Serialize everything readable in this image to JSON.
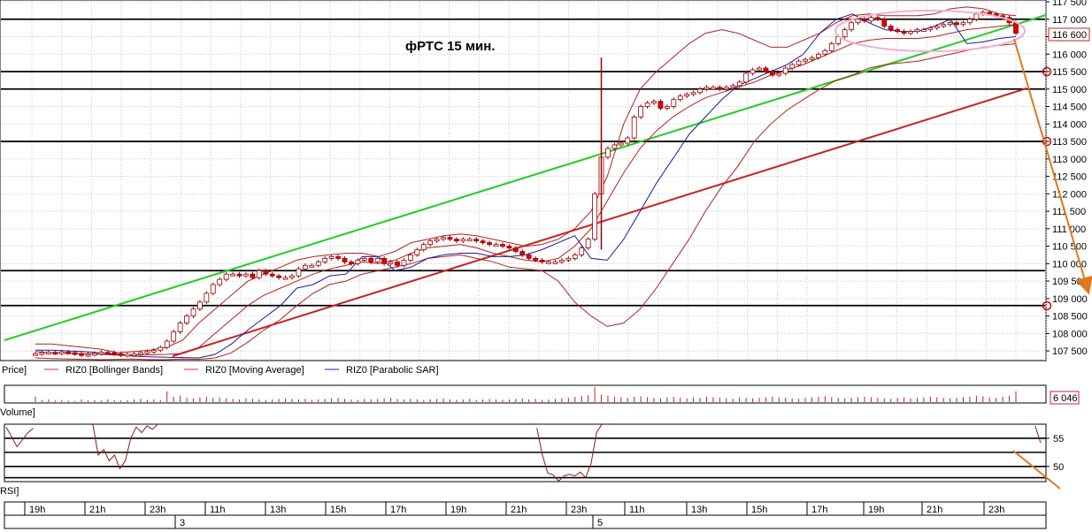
{
  "chart_data": [
    {
      "type": "candlestick",
      "title": "фРТС   15 мин.",
      "ylim": [
        107300,
        117500
      ],
      "y_ticks": [
        107500,
        108000,
        108500,
        109000,
        109500,
        110000,
        110500,
        111000,
        111500,
        112000,
        112500,
        113000,
        113500,
        114000,
        114500,
        115000,
        115500,
        116000,
        116500,
        117000,
        117500
      ],
      "y_tick_labels": [
        "107 500",
        "108 000",
        "108 500",
        "109 000",
        "109 500",
        "110 000",
        "110 500",
        "111 000",
        "111 500",
        "112 000",
        "112 500",
        "113 000",
        "113 500",
        "114 000",
        "114 500",
        "115 000",
        "115 500",
        "116 000",
        "116 500",
        "117 000",
        "117 500"
      ],
      "last_price_label": "116 600",
      "legend": [
        "Price]",
        "RIZ0 [Bollinger Bands]",
        "RIZ0 [Moving Average]",
        "RIZ0 [Parabolic SAR]"
      ],
      "closes": [
        107420,
        107450,
        107460,
        107440,
        107470,
        107450,
        107420,
        107380,
        107400,
        107430,
        107460,
        107450,
        107420,
        107380,
        107400,
        107420,
        107450,
        107480,
        107520,
        107600,
        107780,
        108050,
        108300,
        108500,
        108700,
        108900,
        109150,
        109400,
        109550,
        109700,
        109700,
        109650,
        109700,
        109600,
        109800,
        109700,
        109650,
        109600,
        109600,
        109650,
        109850,
        109950,
        109950,
        110050,
        110150,
        110200,
        110150,
        110050,
        110000,
        110100,
        110150,
        110050,
        110150,
        110000,
        110050,
        109950,
        110100,
        110250,
        110400,
        110550,
        110650,
        110700,
        110750,
        110700,
        110650,
        110700,
        110700,
        110650,
        110600,
        110550,
        110550,
        110500,
        110450,
        110350,
        110250,
        110150,
        110100,
        110050,
        110050,
        110050,
        110100,
        110150,
        110250,
        110450,
        110700,
        112000,
        113050,
        113300,
        113400,
        113450,
        113600,
        114200,
        114500,
        114600,
        114650,
        114450,
        114500,
        114700,
        114800,
        114850,
        114900,
        115000,
        115050,
        115050,
        115000,
        115050,
        115100,
        115200,
        115450,
        115550,
        115600,
        115500,
        115400,
        115450,
        115600,
        115700,
        115800,
        115850,
        115900,
        116000,
        116100,
        116300,
        116500,
        116700,
        116900,
        117000,
        116950,
        117050,
        117000,
        116800,
        116700,
        116650,
        116600,
        116650,
        116700,
        116700,
        116750,
        116800,
        116850,
        116900,
        116850,
        116900,
        117000,
        117150,
        117200,
        117150,
        117100,
        117050,
        116900,
        116600
      ],
      "bollinger_upper": [
        107700,
        107700,
        107650,
        107600,
        107550,
        107450,
        107480,
        107520,
        107600,
        107800,
        108300,
        108700,
        109100,
        109500,
        109700,
        109900,
        110100,
        110200,
        110250,
        110300,
        110300,
        110200,
        110350,
        110600,
        110700,
        110800,
        110850,
        110800,
        110700,
        110600,
        110500,
        110550,
        110700,
        111000,
        111500,
        112500,
        114000,
        115000,
        115500,
        115900,
        116300,
        116600,
        116700,
        116600,
        116400,
        116200,
        116200,
        116400,
        116600,
        116900,
        117100,
        117150,
        117100,
        117100,
        117100,
        117150,
        117300,
        117350,
        117300,
        117150,
        117100
      ],
      "bollinger_lower": [
        107300,
        107280,
        107270,
        107260,
        107250,
        107260,
        107270,
        107250,
        107250,
        107270,
        107260,
        107300,
        107450,
        107750,
        108100,
        108400,
        108800,
        109150,
        109400,
        109500,
        109700,
        109800,
        109900,
        110000,
        110150,
        110200,
        110250,
        110150,
        110050,
        109900,
        109850,
        109800,
        109500,
        108900,
        108500,
        108200,
        108300,
        108700,
        109300,
        110000,
        110700,
        111500,
        112200,
        112800,
        113500,
        114000,
        114400,
        114700,
        115000,
        115250,
        115400,
        115600,
        115700,
        115750,
        115800,
        115900,
        116000,
        116100,
        116200,
        116250,
        116300
      ],
      "moving_average": [
        107480,
        107450,
        107440,
        107420,
        107400,
        107380,
        107380,
        107390,
        107400,
        107430,
        107600,
        108000,
        108400,
        108800,
        109100,
        109300,
        109500,
        109700,
        109850,
        109950,
        110050,
        110000,
        110100,
        110300,
        110450,
        110500,
        110550,
        110450,
        110300,
        110200,
        110100,
        110050,
        110150,
        110500,
        111000,
        111800,
        112600,
        113300,
        113800,
        114200,
        114500,
        114750,
        114900,
        115050,
        115200,
        115400,
        115550,
        115700,
        115900,
        116100,
        116300,
        116400,
        116450,
        116450,
        116450,
        116500,
        116600,
        116700,
        116750,
        116800,
        116850
      ],
      "parabolic_sar": [
        107520,
        107520,
        107500,
        107480,
        107440,
        107400,
        107350,
        107330,
        107320,
        107310,
        107300,
        107400,
        107700,
        108100,
        108450,
        108800,
        109300,
        109400,
        109650,
        109700,
        110200,
        110200,
        109800,
        109900,
        110150,
        110250,
        110300,
        110300,
        110200,
        110200,
        110250,
        110400,
        110600,
        110800,
        110150,
        110100,
        110700,
        111500,
        112300,
        113000,
        113700,
        114200,
        114700,
        115100,
        115300,
        115500,
        115700,
        116000,
        116600,
        117000,
        117150,
        116900,
        116700,
        116650,
        116650,
        116800,
        117000,
        116300,
        116350,
        116450,
        116500
      ],
      "support_resistance_levels": [
        117000,
        115500,
        115000,
        113500,
        109800,
        108800
      ],
      "x_tick_labels": [
        "19h",
        "21h",
        "23h",
        "11h",
        "13h",
        "15h",
        "17h",
        "19h",
        "21h",
        "23h",
        "11h",
        "13h",
        "15h",
        "17h",
        "19h",
        "21h",
        "23h"
      ],
      "day_labels": [
        "3",
        "5"
      ]
    },
    {
      "type": "bar",
      "label": "Volume]",
      "last_value_label": "6 046",
      "values": [
        10,
        4,
        5,
        3,
        4,
        3,
        2,
        5,
        3,
        4,
        3,
        5,
        4,
        3,
        4,
        5,
        6,
        4,
        5,
        4,
        20,
        10,
        12,
        8,
        7,
        9,
        10,
        8,
        9,
        7,
        6,
        5,
        7,
        6,
        5,
        4,
        5,
        6,
        7,
        6,
        5,
        6,
        4,
        5,
        6,
        7,
        8,
        6,
        5,
        4,
        6,
        5,
        6,
        7,
        8,
        6,
        5,
        6,
        5,
        4,
        5,
        6,
        7,
        5,
        4,
        5,
        6,
        4,
        5,
        6,
        5,
        4,
        5,
        6,
        7,
        5,
        6,
        4,
        5,
        6,
        7,
        8,
        10,
        12,
        13,
        28,
        14,
        12,
        10,
        9,
        8,
        10,
        11,
        9,
        8,
        7,
        9,
        10,
        8,
        7,
        9,
        8,
        10,
        9,
        8,
        7,
        6,
        9,
        8,
        7,
        8,
        9,
        10,
        9,
        8,
        7,
        6,
        8,
        9,
        10,
        11,
        9,
        8,
        7,
        8,
        9,
        10,
        9,
        8,
        7,
        6,
        8,
        9,
        7,
        8,
        9,
        10,
        9,
        8,
        7,
        8,
        9,
        10,
        12,
        11,
        9,
        8,
        10,
        12,
        20
      ]
    },
    {
      "type": "line",
      "label": "RSI]",
      "ylim": [
        47.3,
        57.5
      ],
      "y_tick_labels": [
        "55",
        "50"
      ],
      "levels": [
        55,
        52.5,
        50,
        48
      ],
      "segments": [
        [
          [
            0,
            57.0
          ],
          [
            2,
            53.5
          ],
          [
            4,
            56.0
          ],
          [
            5,
            56.8
          ]
        ],
        [
          [
            16,
            57.5
          ],
          [
            17,
            52.0
          ],
          [
            18,
            53.0
          ],
          [
            19,
            51.0
          ],
          [
            20,
            52.0
          ],
          [
            21,
            49.6
          ],
          [
            22,
            51.0
          ],
          [
            23,
            55.0
          ],
          [
            24,
            57.0
          ],
          [
            25,
            56.0
          ],
          [
            26,
            57.2
          ],
          [
            27,
            56.6
          ],
          [
            28,
            57.5
          ]
        ],
        [
          [
            98,
            56.8
          ],
          [
            99,
            52.0
          ],
          [
            100,
            48.8
          ],
          [
            101,
            48.5
          ],
          [
            102,
            47.4
          ],
          [
            103,
            48.3
          ],
          [
            104,
            48.6
          ],
          [
            105,
            48.3
          ],
          [
            106,
            49.0
          ],
          [
            107,
            48.0
          ],
          [
            108,
            50.5
          ],
          [
            109,
            56.0
          ],
          [
            110,
            57.5
          ]
        ],
        [
          [
            190,
            57.2
          ],
          [
            191,
            54.2
          ]
        ]
      ]
    }
  ],
  "annotations": [
    "highlight-ellipse",
    "up-trend-line",
    "lower-trend-line",
    "forecast-arrow-price",
    "forecast-arrow-rsi"
  ]
}
